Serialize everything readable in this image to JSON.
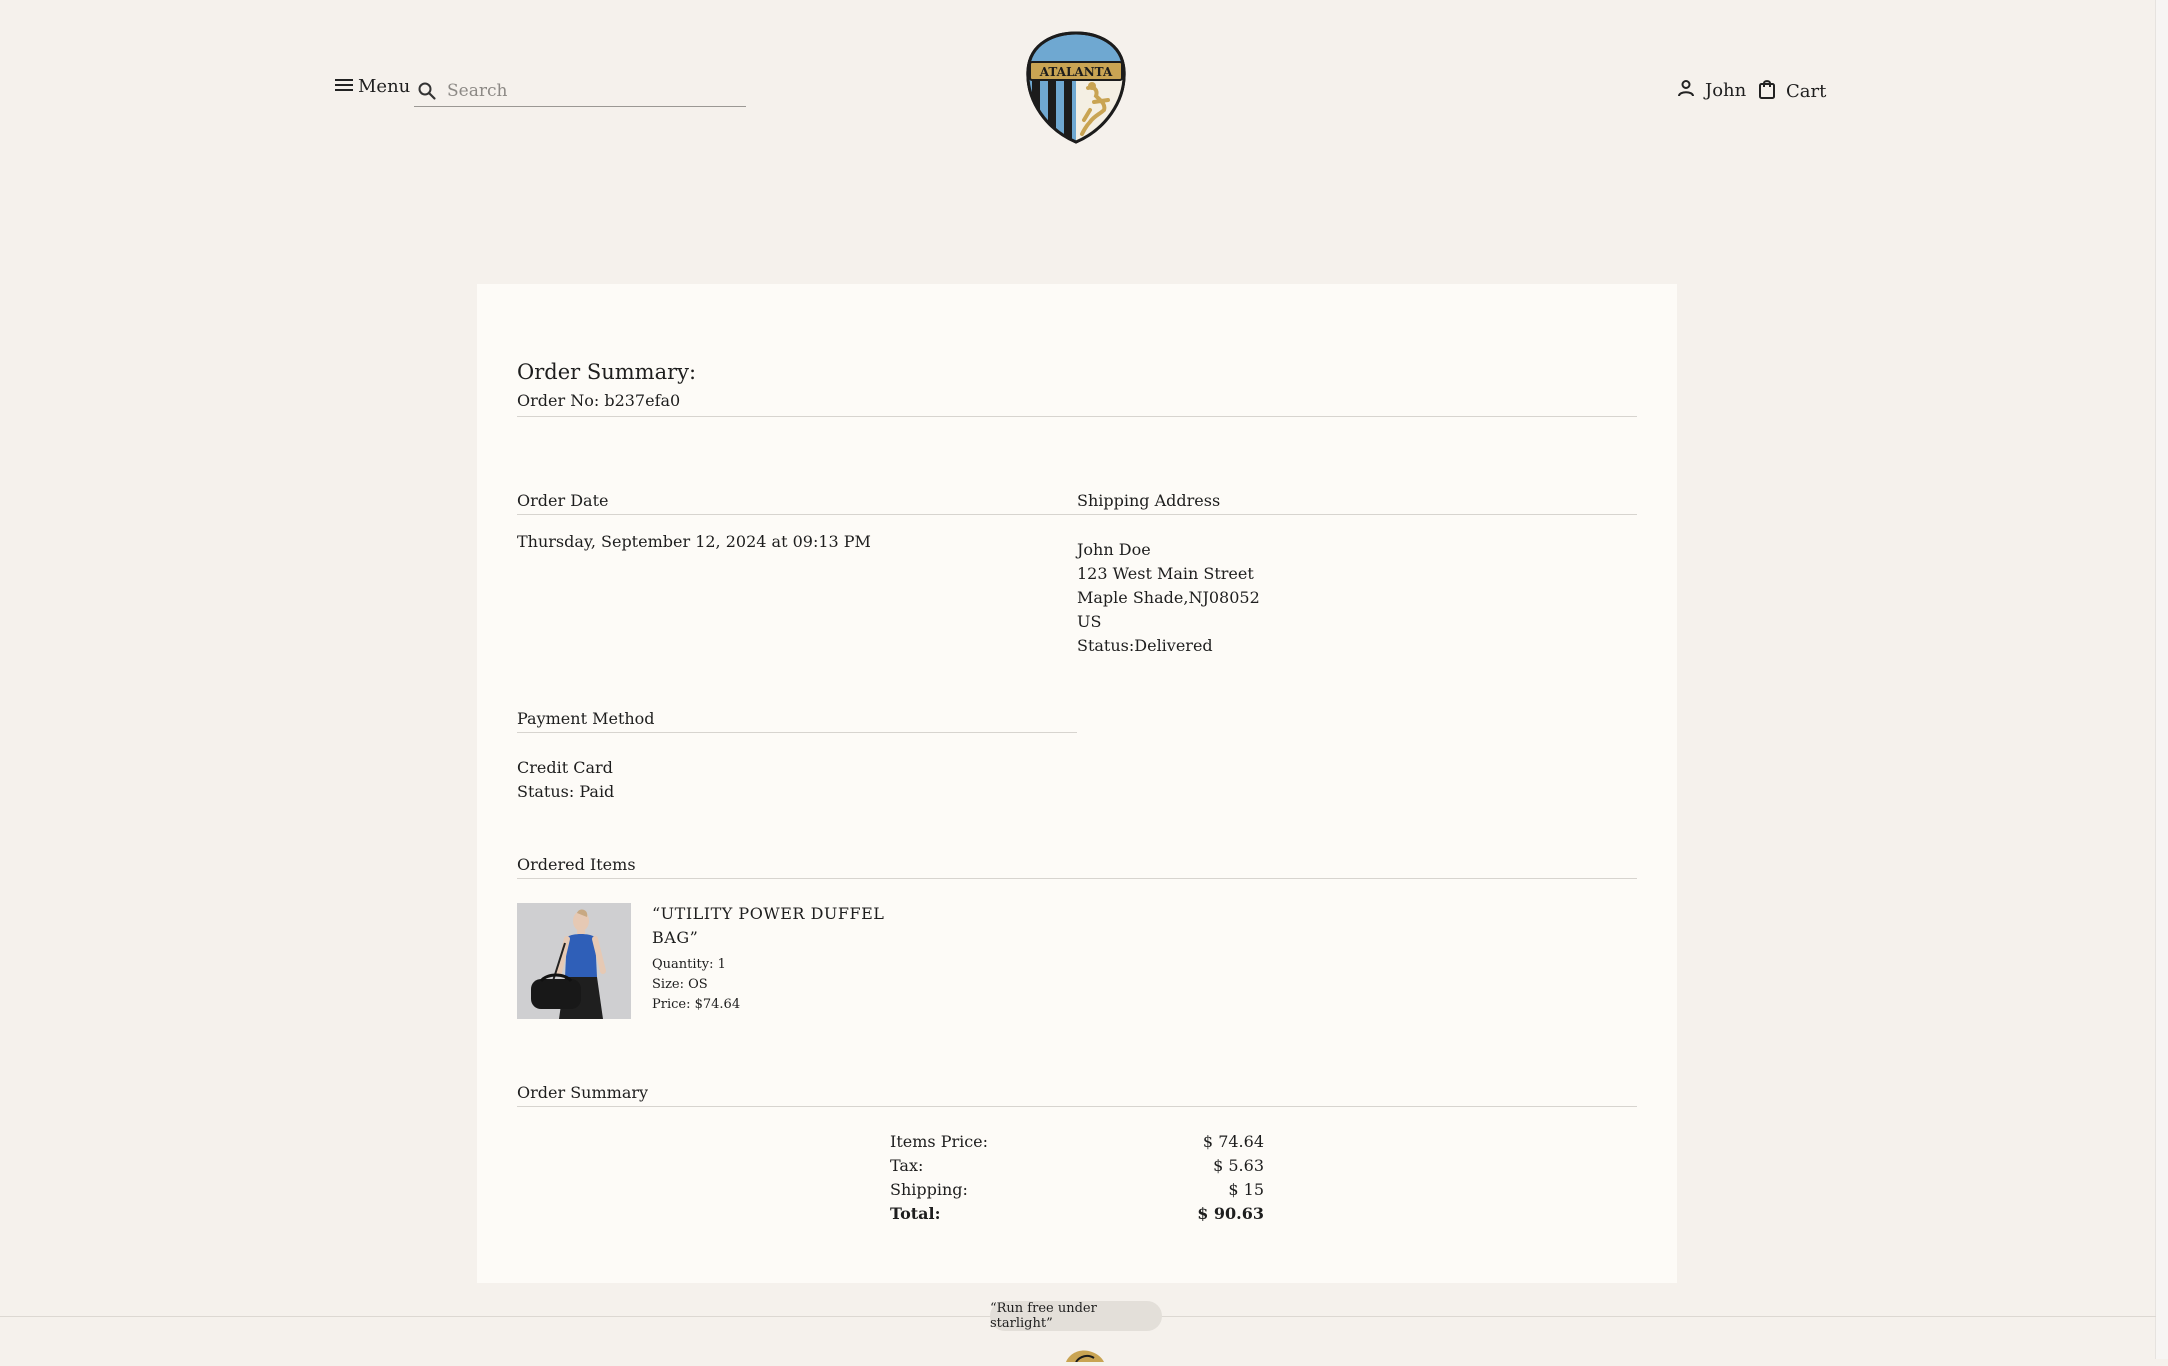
{
  "header": {
    "menu_label": "Menu",
    "search_placeholder": "Search",
    "logo_text": "ATALANTA",
    "user_label": "John",
    "cart_label": "Cart"
  },
  "order": {
    "title": "Order Summary:",
    "order_no": "Order No: b237efa0",
    "date_label": "Order Date",
    "date_value": "Thursday, September 12, 2024 at 09:13 PM",
    "shipping_label": "Shipping Address",
    "shipping_lines": [
      "John Doe",
      "123 West Main Street",
      "Maple Shade,NJ08052",
      "US",
      "Status:Delivered"
    ],
    "payment_label": "Payment Method",
    "payment_method": "Credit Card",
    "payment_status": "Status: Paid",
    "items_label": "Ordered Items",
    "items": [
      {
        "name": "“UTILITY POWER DUFFEL BAG”",
        "quantity": "Quantity: 1",
        "size": "Size: OS",
        "price": "Price: $74.64"
      }
    ],
    "summary_label": "Order Summary",
    "summary": [
      {
        "label": "Items Price:",
        "value": "$ 74.64"
      },
      {
        "label": "Tax:",
        "value": "$ 5.63"
      },
      {
        "label": "Shipping:",
        "value": "$ 15"
      },
      {
        "label": "Total:",
        "value": "$ 90.63"
      }
    ]
  },
  "footer": {
    "tagline": "“Run free under starlight”"
  },
  "colors": {
    "page_bg": "#f5f1ec",
    "card_bg": "#fdfbf7",
    "logo_blue": "#6fa8d1",
    "logo_gold": "#c9a453",
    "logo_dark": "#1c1c1c"
  }
}
